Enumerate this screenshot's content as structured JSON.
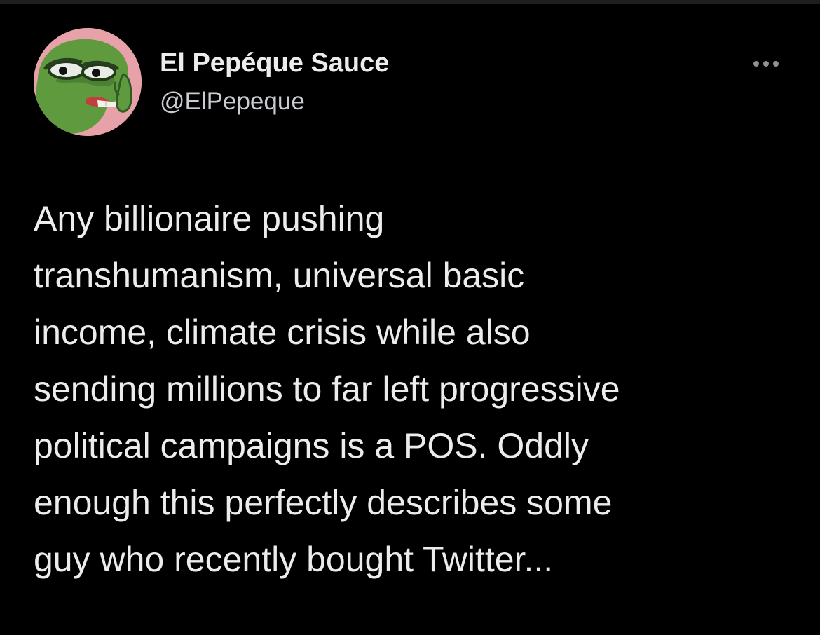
{
  "tweet": {
    "author": {
      "display_name": "El Pepéque Sauce",
      "handle": "@ElPepeque",
      "avatar_icon": "frog-avatar-icon"
    },
    "more_icon": "more-horizontal-icon",
    "text_lines": [
      "Any billionaire pushing",
      "transhumanism, universal basic",
      "income, climate crisis while also",
      "sending millions to far left progressive",
      "political campaigns is a POS. Oddly",
      "enough this perfectly describes some",
      "guy who recently bought Twitter..."
    ]
  },
  "colors": {
    "background": "#000000",
    "text": "#ececec",
    "secondary_text": "#c9cdd1",
    "avatar_background": "#e7a1a8",
    "avatar_frog": "#5f9a3f"
  }
}
